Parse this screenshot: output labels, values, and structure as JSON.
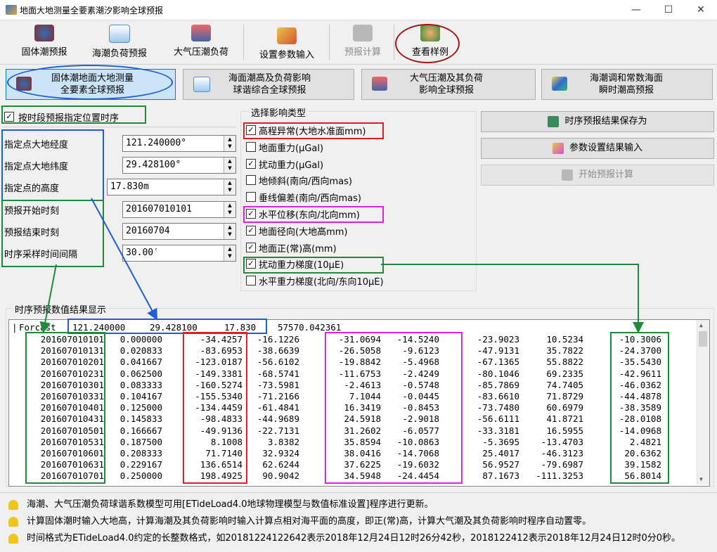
{
  "window": {
    "title": "地面大地测量全要素潮汐影响全球预报"
  },
  "toolbar": {
    "items": [
      {
        "label": "固体潮预报",
        "icon": "globe-icon"
      },
      {
        "label": "海潮负荷预报",
        "icon": "wave-chart-icon"
      },
      {
        "label": "大气压潮负荷",
        "icon": "building-icon"
      },
      {
        "label": "设置参数输入",
        "icon": "wrench-icon"
      },
      {
        "label": "预报计算",
        "icon": "laptop-icon"
      },
      {
        "label": "查看样例",
        "icon": "person-icon"
      }
    ]
  },
  "tabs": [
    {
      "line1": "固体潮地面大地测量",
      "line2": "全要素全球预报"
    },
    {
      "line1": "海面潮高及负荷影响",
      "line2": "球谐综合全球预报"
    },
    {
      "line1": "大气压潮及其负荷",
      "line2": "影响全球预报"
    },
    {
      "line1": "海潮调和常数海面",
      "line2": "瞬时潮高预报"
    }
  ],
  "left": {
    "timeseries_checkbox": {
      "label": "按时段预报指定位置时序",
      "checked": true
    },
    "fields": [
      {
        "label": "指定点大地经度",
        "value": "121.240000°"
      },
      {
        "label": "指定点大地纬度",
        "value": "29.428100°"
      },
      {
        "label": "指定点的高度",
        "value": "17.830m"
      },
      {
        "label": "预报开始时刻",
        "value": "201607010101"
      },
      {
        "label": "预报结束时刻",
        "value": "20160704"
      },
      {
        "label": "时序采样时间间隔",
        "value": "30.00′"
      }
    ]
  },
  "effects": {
    "group_label": "选择影响类型",
    "items": [
      {
        "label": "高程异常(大地水准面mm)",
        "checked": true
      },
      {
        "label": "地面重力(μGal)",
        "checked": false
      },
      {
        "label": "扰动重力(μGal)",
        "checked": true
      },
      {
        "label": "地倾斜(南向/西向mas)",
        "checked": false
      },
      {
        "label": "垂线偏差(南向/西向mas)",
        "checked": false
      },
      {
        "label": "水平位移(东向/北向mm)",
        "checked": true
      },
      {
        "label": "地面径向(大地高mm)",
        "checked": true
      },
      {
        "label": "地面正(常)高(mm)",
        "checked": true
      },
      {
        "label": "扰动重力梯度(10μE)",
        "checked": true
      },
      {
        "label": "水平重力梯度(北向/东向10μE)",
        "checked": false
      }
    ]
  },
  "actions": [
    {
      "label": "时序预报结果保存为",
      "icon": "save-icon",
      "enabled": true
    },
    {
      "label": "参数设置结果输入",
      "icon": "input-icon",
      "enabled": true
    },
    {
      "label": "开始预报计算",
      "icon": "compute-icon",
      "enabled": false
    }
  ],
  "results": {
    "group_label": "时序预报数值结果显示",
    "header": {
      "prefix": "Forcast",
      "lon": "121.240000",
      "lat": "29.428100",
      "h": "17.830",
      "extra": "57570.042361"
    },
    "rows": [
      [
        "201607010101",
        "0.000000",
        "-34.4257",
        "-16.1226",
        "-31.0694",
        "-14.5240",
        "-23.9023",
        "10.5234",
        "-10.3006"
      ],
      [
        "201607010131",
        "0.020833",
        "-83.6953",
        "-38.6639",
        "-26.5058",
        "-9.6123",
        "-47.9131",
        "35.7822",
        "-24.3700"
      ],
      [
        "201607010201",
        "0.041667",
        "-123.0187",
        "-56.6102",
        "-19.8842",
        "-5.4968",
        "-67.1365",
        "55.8822",
        "-35.5430"
      ],
      [
        "201607010231",
        "0.062500",
        "-149.3381",
        "-68.5741",
        "-11.6753",
        "-2.4249",
        "-80.1046",
        "69.2335",
        "-42.9611"
      ],
      [
        "201607010301",
        "0.083333",
        "-160.5274",
        "-73.5981",
        "-2.4613",
        "-0.5748",
        "-85.7869",
        "74.7405",
        "-46.0362"
      ],
      [
        "201607010331",
        "0.104167",
        "-155.5340",
        "-71.2166",
        "7.1044",
        "-0.0445",
        "-83.6610",
        "71.8729",
        "-44.4878"
      ],
      [
        "201607010401",
        "0.125000",
        "-134.4459",
        "-61.4841",
        "16.3419",
        "-0.8453",
        "-73.7480",
        "60.6979",
        "-38.3589"
      ],
      [
        "201607010431",
        "0.145833",
        "-98.4833",
        "-44.9689",
        "24.5918",
        "-2.9018",
        "-56.6111",
        "41.8721",
        "-28.0108"
      ],
      [
        "201607010501",
        "0.166667",
        "-49.9136",
        "-22.7131",
        "31.2602",
        "-6.0577",
        "-33.3181",
        "16.5955",
        "-14.0968"
      ],
      [
        "201607010531",
        "0.187500",
        "8.1008",
        "3.8382",
        "35.8594",
        "-10.0863",
        "-5.3695",
        "-13.4703",
        "2.4821"
      ],
      [
        "201607010601",
        "0.208333",
        "71.7140",
        "32.9324",
        "38.0416",
        "-14.7068",
        "25.4017",
        "-46.3123",
        "20.6362"
      ],
      [
        "201607010631",
        "0.229167",
        "136.6514",
        "62.6244",
        "37.6225",
        "-19.6032",
        "56.9527",
        "-79.6987",
        "39.1582"
      ],
      [
        "201607010701",
        "0.250000",
        "198.4925",
        "90.9042",
        "34.5948",
        "-24.4454",
        "87.1673",
        "-111.3253",
        "56.8014"
      ]
    ]
  },
  "notes": [
    "海潮、大气压潮负荷球谐系数模型可用[ETideLoad4.0地球物理模型与数值标准设置]程序进行更新。",
    "计算固体潮时输入大地高，计算海潮及其负荷影响时输入计算点相对海平面的高度，即正(常)高，计算大气潮及其负荷影响时程序自动置零。",
    "时间格式为ETideLoad4.0约定的长整数格式，如20181224122642表示2018年12月24日12时26分42秒，2018122412表示2018年12月24日12时0分0秒。"
  ],
  "colors": {
    "annot_red": "#e02020",
    "annot_blue": "#1f5fd6",
    "annot_green": "#1f8a3a",
    "annot_magenta": "#e020e0",
    "annot_darkred": "#a01818"
  }
}
